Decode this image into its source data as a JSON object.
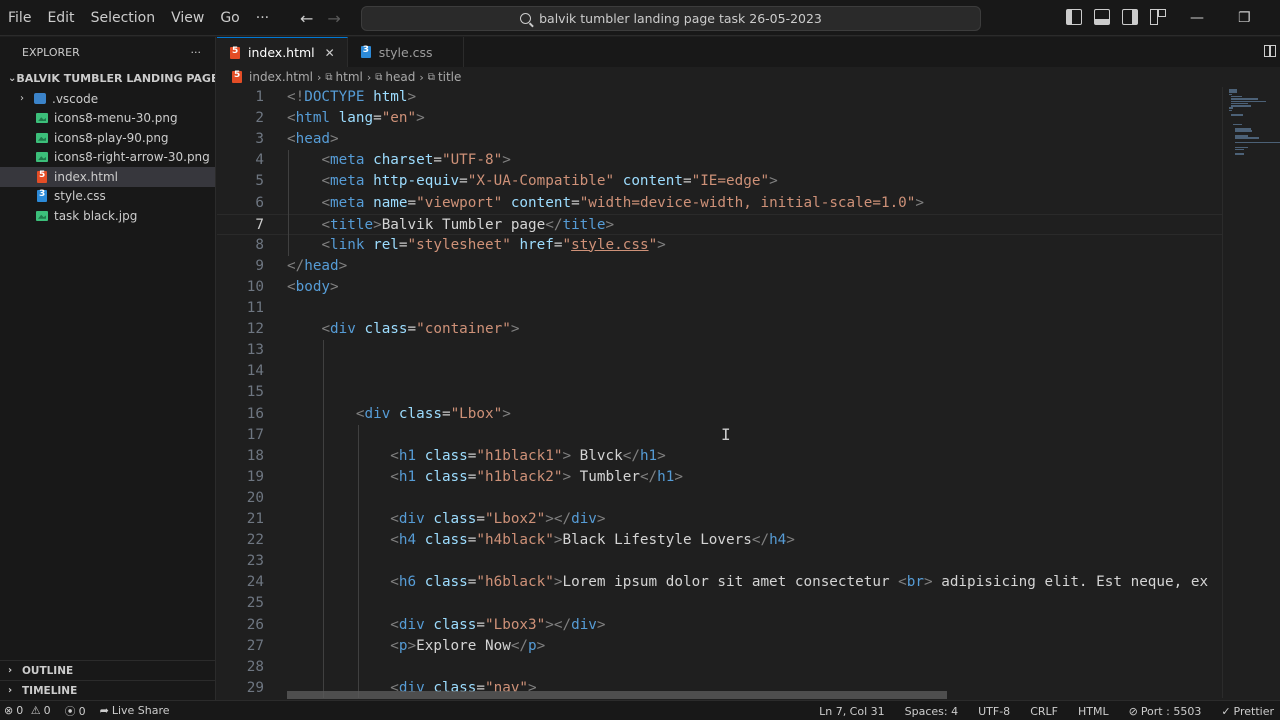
{
  "menu": [
    "File",
    "Edit",
    "Selection",
    "View",
    "Go",
    "···"
  ],
  "search": {
    "label": "balvik tumbler landing page task 26-05-2023"
  },
  "window_controls": {
    "minimize": "—",
    "restore": "❐"
  },
  "explorer": {
    "title": "EXPLORER",
    "more": "···",
    "folder": "BALVIK TUMBLER LANDING PAGE TASK ...",
    "items": [
      {
        "label": ".vscode",
        "type": "folder"
      },
      {
        "label": "icons8-menu-30.png",
        "type": "image"
      },
      {
        "label": "icons8-play-90.png",
        "type": "image"
      },
      {
        "label": "icons8-right-arrow-30.png",
        "type": "image"
      },
      {
        "label": "index.html",
        "type": "html"
      },
      {
        "label": "style.css",
        "type": "css"
      },
      {
        "label": "task black.jpg",
        "type": "image"
      }
    ],
    "outline": "OUTLINE",
    "timeline": "TIMELINE"
  },
  "tabs": [
    {
      "label": "index.html",
      "close": "✕"
    },
    {
      "label": "style.css"
    }
  ],
  "breadcrumb": [
    "index.html",
    "html",
    "head",
    "title"
  ],
  "editor": {
    "current_line": 7,
    "lines": [
      [
        [
          "p",
          "<!"
        ],
        [
          "t",
          "DOCTYPE"
        ],
        [
          "x",
          " "
        ],
        [
          "a",
          "html"
        ],
        [
          "p",
          ">"
        ]
      ],
      [
        [
          "p",
          "<"
        ],
        [
          "t",
          "html"
        ],
        [
          "x",
          " "
        ],
        [
          "a",
          "lang"
        ],
        [
          "e",
          "="
        ],
        [
          "s",
          "\"en\""
        ],
        [
          "p",
          ">"
        ]
      ],
      [
        [
          "p",
          "<"
        ],
        [
          "t",
          "head"
        ],
        [
          "p",
          ">"
        ]
      ],
      [
        [
          "x",
          "    "
        ],
        [
          "p",
          "<"
        ],
        [
          "t",
          "meta"
        ],
        [
          "x",
          " "
        ],
        [
          "a",
          "charset"
        ],
        [
          "e",
          "="
        ],
        [
          "s",
          "\"UTF-8\""
        ],
        [
          "p",
          ">"
        ]
      ],
      [
        [
          "x",
          "    "
        ],
        [
          "p",
          "<"
        ],
        [
          "t",
          "meta"
        ],
        [
          "x",
          " "
        ],
        [
          "a",
          "http-equiv"
        ],
        [
          "e",
          "="
        ],
        [
          "s",
          "\"X-UA-Compatible\""
        ],
        [
          "x",
          " "
        ],
        [
          "a",
          "content"
        ],
        [
          "e",
          "="
        ],
        [
          "s",
          "\"IE=edge\""
        ],
        [
          "p",
          ">"
        ]
      ],
      [
        [
          "x",
          "    "
        ],
        [
          "p",
          "<"
        ],
        [
          "t",
          "meta"
        ],
        [
          "x",
          " "
        ],
        [
          "a",
          "name"
        ],
        [
          "e",
          "="
        ],
        [
          "s",
          "\"viewport\""
        ],
        [
          "x",
          " "
        ],
        [
          "a",
          "content"
        ],
        [
          "e",
          "="
        ],
        [
          "s",
          "\"width=device-width, initial-scale=1.0\""
        ],
        [
          "p",
          ">"
        ]
      ],
      [
        [
          "x",
          "    "
        ],
        [
          "p",
          "<"
        ],
        [
          "t",
          "title"
        ],
        [
          "p",
          ">"
        ],
        [
          "x",
          "Balvik Tumbler page"
        ],
        [
          "p",
          "</"
        ],
        [
          "t",
          "title"
        ],
        [
          "p",
          ">"
        ]
      ],
      [
        [
          "x",
          "    "
        ],
        [
          "p",
          "<"
        ],
        [
          "t",
          "link"
        ],
        [
          "x",
          " "
        ],
        [
          "a",
          "rel"
        ],
        [
          "e",
          "="
        ],
        [
          "s",
          "\"stylesheet\""
        ],
        [
          "x",
          " "
        ],
        [
          "a",
          "href"
        ],
        [
          "e",
          "="
        ],
        [
          "s",
          "\""
        ],
        [
          "su",
          "style.css"
        ],
        [
          "s",
          "\""
        ],
        [
          "p",
          ">"
        ]
      ],
      [
        [
          "p",
          "</"
        ],
        [
          "t",
          "head"
        ],
        [
          "p",
          ">"
        ]
      ],
      [
        [
          "p",
          "<"
        ],
        [
          "t",
          "body"
        ],
        [
          "p",
          ">"
        ]
      ],
      [],
      [
        [
          "x",
          "    "
        ],
        [
          "p",
          "<"
        ],
        [
          "t",
          "div"
        ],
        [
          "x",
          " "
        ],
        [
          "a",
          "class"
        ],
        [
          "e",
          "="
        ],
        [
          "s",
          "\"container\""
        ],
        [
          "p",
          ">"
        ]
      ],
      [],
      [],
      [],
      [
        [
          "x",
          "        "
        ],
        [
          "p",
          "<"
        ],
        [
          "t",
          "div"
        ],
        [
          "x",
          " "
        ],
        [
          "a",
          "class"
        ],
        [
          "e",
          "="
        ],
        [
          "s",
          "\"Lbox\""
        ],
        [
          "p",
          ">"
        ]
      ],
      [],
      [
        [
          "x",
          "            "
        ],
        [
          "p",
          "<"
        ],
        [
          "t",
          "h1"
        ],
        [
          "x",
          " "
        ],
        [
          "a",
          "class"
        ],
        [
          "e",
          "="
        ],
        [
          "s",
          "\"h1black1\""
        ],
        [
          "p",
          ">"
        ],
        [
          "x",
          " Blvck"
        ],
        [
          "p",
          "</"
        ],
        [
          "t",
          "h1"
        ],
        [
          "p",
          ">"
        ]
      ],
      [
        [
          "x",
          "            "
        ],
        [
          "p",
          "<"
        ],
        [
          "t",
          "h1"
        ],
        [
          "x",
          " "
        ],
        [
          "a",
          "class"
        ],
        [
          "e",
          "="
        ],
        [
          "s",
          "\"h1black2\""
        ],
        [
          "p",
          ">"
        ],
        [
          "x",
          " Tumbler"
        ],
        [
          "p",
          "</"
        ],
        [
          "t",
          "h1"
        ],
        [
          "p",
          ">"
        ]
      ],
      [],
      [
        [
          "x",
          "            "
        ],
        [
          "p",
          "<"
        ],
        [
          "t",
          "div"
        ],
        [
          "x",
          " "
        ],
        [
          "a",
          "class"
        ],
        [
          "e",
          "="
        ],
        [
          "s",
          "\"Lbox2\""
        ],
        [
          "p",
          "></"
        ],
        [
          "t",
          "div"
        ],
        [
          "p",
          ">"
        ]
      ],
      [
        [
          "x",
          "            "
        ],
        [
          "p",
          "<"
        ],
        [
          "t",
          "h4"
        ],
        [
          "x",
          " "
        ],
        [
          "a",
          "class"
        ],
        [
          "e",
          "="
        ],
        [
          "s",
          "\"h4black\""
        ],
        [
          "p",
          ">"
        ],
        [
          "x",
          "Black Lifestyle Lovers"
        ],
        [
          "p",
          "</"
        ],
        [
          "t",
          "h4"
        ],
        [
          "p",
          ">"
        ]
      ],
      [],
      [
        [
          "x",
          "            "
        ],
        [
          "p",
          "<"
        ],
        [
          "t",
          "h6"
        ],
        [
          "x",
          " "
        ],
        [
          "a",
          "class"
        ],
        [
          "e",
          "="
        ],
        [
          "s",
          "\"h6black\""
        ],
        [
          "p",
          ">"
        ],
        [
          "x",
          "Lorem ipsum dolor sit amet consectetur "
        ],
        [
          "p",
          "<"
        ],
        [
          "t",
          "br"
        ],
        [
          "p",
          ">"
        ],
        [
          "x",
          " adipisicing elit. Est neque, ex"
        ]
      ],
      [],
      [
        [
          "x",
          "            "
        ],
        [
          "p",
          "<"
        ],
        [
          "t",
          "div"
        ],
        [
          "x",
          " "
        ],
        [
          "a",
          "class"
        ],
        [
          "e",
          "="
        ],
        [
          "s",
          "\"Lbox3\""
        ],
        [
          "p",
          "></"
        ],
        [
          "t",
          "div"
        ],
        [
          "p",
          ">"
        ]
      ],
      [
        [
          "x",
          "            "
        ],
        [
          "p",
          "<"
        ],
        [
          "t",
          "p"
        ],
        [
          "p",
          ">"
        ],
        [
          "x",
          "Explore Now"
        ],
        [
          "p",
          "</"
        ],
        [
          "t",
          "p"
        ],
        [
          "p",
          ">"
        ]
      ],
      [],
      [
        [
          "x",
          "            "
        ],
        [
          "p",
          "<"
        ],
        [
          "t",
          "div"
        ],
        [
          "x",
          " "
        ],
        [
          "a",
          "class"
        ],
        [
          "e",
          "="
        ],
        [
          "s",
          "\"nav\""
        ],
        [
          "p",
          ">"
        ]
      ]
    ]
  },
  "status": {
    "errors": "0",
    "warnings": "0",
    "ports": "0",
    "live_share": "Live Share",
    "position": "Ln 7, Col 31",
    "spaces": "Spaces: 4",
    "encoding": "UTF-8",
    "eol": "CRLF",
    "language": "HTML",
    "port": "Port : 5503",
    "prettier": "Prettier"
  }
}
